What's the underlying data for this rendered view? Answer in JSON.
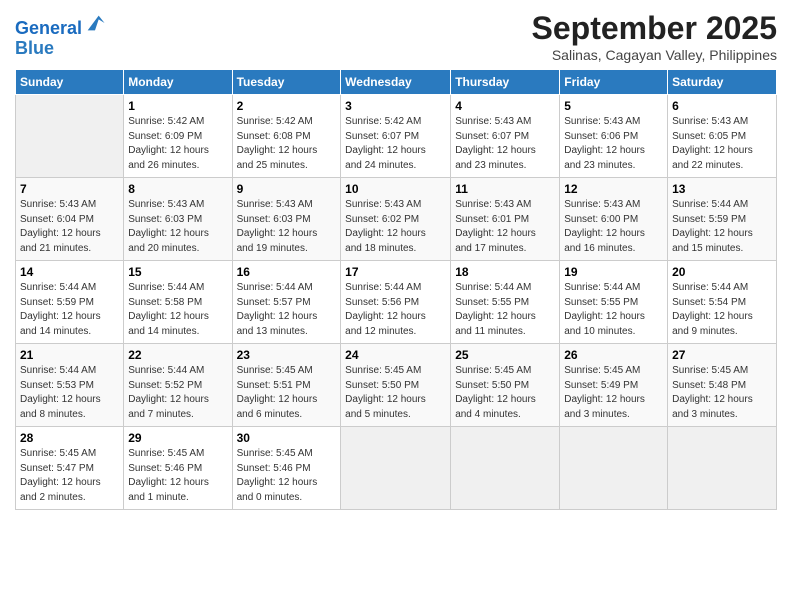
{
  "header": {
    "logo_line1": "General",
    "logo_line2": "Blue",
    "month": "September 2025",
    "location": "Salinas, Cagayan Valley, Philippines"
  },
  "days_of_week": [
    "Sunday",
    "Monday",
    "Tuesday",
    "Wednesday",
    "Thursday",
    "Friday",
    "Saturday"
  ],
  "weeks": [
    [
      {
        "day": "",
        "info": ""
      },
      {
        "day": "1",
        "info": "Sunrise: 5:42 AM\nSunset: 6:09 PM\nDaylight: 12 hours\nand 26 minutes."
      },
      {
        "day": "2",
        "info": "Sunrise: 5:42 AM\nSunset: 6:08 PM\nDaylight: 12 hours\nand 25 minutes."
      },
      {
        "day": "3",
        "info": "Sunrise: 5:42 AM\nSunset: 6:07 PM\nDaylight: 12 hours\nand 24 minutes."
      },
      {
        "day": "4",
        "info": "Sunrise: 5:43 AM\nSunset: 6:07 PM\nDaylight: 12 hours\nand 23 minutes."
      },
      {
        "day": "5",
        "info": "Sunrise: 5:43 AM\nSunset: 6:06 PM\nDaylight: 12 hours\nand 23 minutes."
      },
      {
        "day": "6",
        "info": "Sunrise: 5:43 AM\nSunset: 6:05 PM\nDaylight: 12 hours\nand 22 minutes."
      }
    ],
    [
      {
        "day": "7",
        "info": "Sunrise: 5:43 AM\nSunset: 6:04 PM\nDaylight: 12 hours\nand 21 minutes."
      },
      {
        "day": "8",
        "info": "Sunrise: 5:43 AM\nSunset: 6:03 PM\nDaylight: 12 hours\nand 20 minutes."
      },
      {
        "day": "9",
        "info": "Sunrise: 5:43 AM\nSunset: 6:03 PM\nDaylight: 12 hours\nand 19 minutes."
      },
      {
        "day": "10",
        "info": "Sunrise: 5:43 AM\nSunset: 6:02 PM\nDaylight: 12 hours\nand 18 minutes."
      },
      {
        "day": "11",
        "info": "Sunrise: 5:43 AM\nSunset: 6:01 PM\nDaylight: 12 hours\nand 17 minutes."
      },
      {
        "day": "12",
        "info": "Sunrise: 5:43 AM\nSunset: 6:00 PM\nDaylight: 12 hours\nand 16 minutes."
      },
      {
        "day": "13",
        "info": "Sunrise: 5:44 AM\nSunset: 5:59 PM\nDaylight: 12 hours\nand 15 minutes."
      }
    ],
    [
      {
        "day": "14",
        "info": "Sunrise: 5:44 AM\nSunset: 5:59 PM\nDaylight: 12 hours\nand 14 minutes."
      },
      {
        "day": "15",
        "info": "Sunrise: 5:44 AM\nSunset: 5:58 PM\nDaylight: 12 hours\nand 14 minutes."
      },
      {
        "day": "16",
        "info": "Sunrise: 5:44 AM\nSunset: 5:57 PM\nDaylight: 12 hours\nand 13 minutes."
      },
      {
        "day": "17",
        "info": "Sunrise: 5:44 AM\nSunset: 5:56 PM\nDaylight: 12 hours\nand 12 minutes."
      },
      {
        "day": "18",
        "info": "Sunrise: 5:44 AM\nSunset: 5:55 PM\nDaylight: 12 hours\nand 11 minutes."
      },
      {
        "day": "19",
        "info": "Sunrise: 5:44 AM\nSunset: 5:55 PM\nDaylight: 12 hours\nand 10 minutes."
      },
      {
        "day": "20",
        "info": "Sunrise: 5:44 AM\nSunset: 5:54 PM\nDaylight: 12 hours\nand 9 minutes."
      }
    ],
    [
      {
        "day": "21",
        "info": "Sunrise: 5:44 AM\nSunset: 5:53 PM\nDaylight: 12 hours\nand 8 minutes."
      },
      {
        "day": "22",
        "info": "Sunrise: 5:44 AM\nSunset: 5:52 PM\nDaylight: 12 hours\nand 7 minutes."
      },
      {
        "day": "23",
        "info": "Sunrise: 5:45 AM\nSunset: 5:51 PM\nDaylight: 12 hours\nand 6 minutes."
      },
      {
        "day": "24",
        "info": "Sunrise: 5:45 AM\nSunset: 5:50 PM\nDaylight: 12 hours\nand 5 minutes."
      },
      {
        "day": "25",
        "info": "Sunrise: 5:45 AM\nSunset: 5:50 PM\nDaylight: 12 hours\nand 4 minutes."
      },
      {
        "day": "26",
        "info": "Sunrise: 5:45 AM\nSunset: 5:49 PM\nDaylight: 12 hours\nand 3 minutes."
      },
      {
        "day": "27",
        "info": "Sunrise: 5:45 AM\nSunset: 5:48 PM\nDaylight: 12 hours\nand 3 minutes."
      }
    ],
    [
      {
        "day": "28",
        "info": "Sunrise: 5:45 AM\nSunset: 5:47 PM\nDaylight: 12 hours\nand 2 minutes."
      },
      {
        "day": "29",
        "info": "Sunrise: 5:45 AM\nSunset: 5:46 PM\nDaylight: 12 hours\nand 1 minute."
      },
      {
        "day": "30",
        "info": "Sunrise: 5:45 AM\nSunset: 5:46 PM\nDaylight: 12 hours\nand 0 minutes."
      },
      {
        "day": "",
        "info": ""
      },
      {
        "day": "",
        "info": ""
      },
      {
        "day": "",
        "info": ""
      },
      {
        "day": "",
        "info": ""
      }
    ]
  ]
}
